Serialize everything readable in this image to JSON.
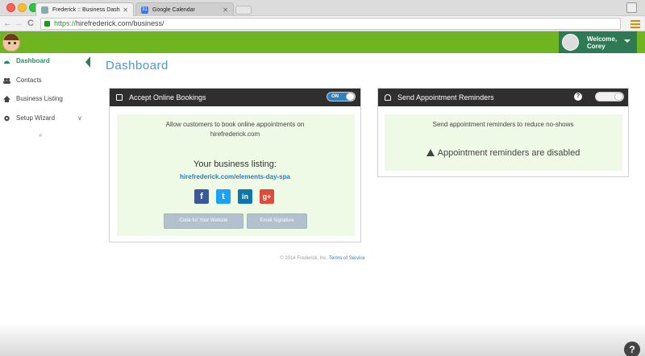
{
  "browser": {
    "tabs": [
      {
        "label": "Frederick :: Business Dash",
        "active": true
      },
      {
        "label": "Google Calendar",
        "active": false
      }
    ],
    "url_scheme": "https://",
    "url_rest": "hirefrederick.com/business/"
  },
  "header": {
    "welcome_label": "Welcome,",
    "user_name": "Corey",
    "accent": "#6fb51f",
    "user_bg": "#2d7a55"
  },
  "sidebar": {
    "items": [
      {
        "label": "Dashboard",
        "icon": "dashboard-icon",
        "active": true
      },
      {
        "label": "Contacts",
        "icon": "contacts-icon"
      },
      {
        "label": "Business Listing",
        "icon": "home-icon"
      },
      {
        "label": "Setup Wizard",
        "icon": "gear-icon"
      }
    ],
    "collapse_glyph": "«"
  },
  "main": {
    "title": "Dashboard",
    "bookings": {
      "title": "Accept Online Bookings",
      "toggle_label": "ON",
      "toggle_on": true,
      "desc_line1": "Allow customers to book online appointments on",
      "desc_line2": "hirefrederick.com",
      "listing_label": "Your business listing:",
      "listing_link": "hirefrederick.com/elements-day-spa",
      "social": [
        "f",
        "t",
        "in",
        "g+"
      ],
      "btn_code": "Code for Your Website",
      "btn_email": "Email Signature"
    },
    "reminders": {
      "title": "Send Appointment Reminders",
      "help": "?",
      "toggle_on": false,
      "desc": "Send appointment reminders to reduce no-shows",
      "warning": "Appointment reminders are disabled"
    }
  },
  "footer": {
    "copyright": "© 2014 Frederick, Inc.",
    "tos": "Terms of Service"
  }
}
